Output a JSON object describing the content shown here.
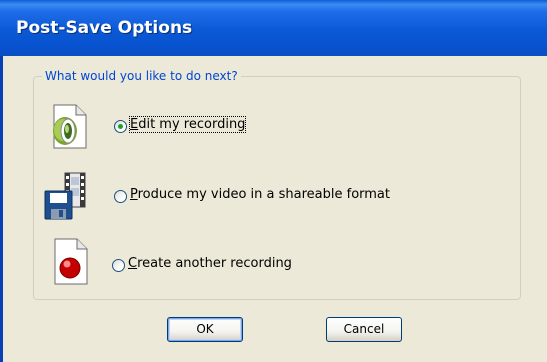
{
  "window": {
    "title": "Post-Save Options"
  },
  "group": {
    "label": "What would you like to do next?"
  },
  "options": [
    {
      "mnemonic": "E",
      "rest": "dit my recording",
      "selected": true,
      "icon": "edit-recording-icon"
    },
    {
      "mnemonic": "P",
      "rest": "roduce my video in a shareable format",
      "selected": false,
      "icon": "produce-video-icon"
    },
    {
      "mnemonic": "C",
      "rest": "reate another recording",
      "selected": false,
      "icon": "new-recording-icon"
    }
  ],
  "buttons": {
    "ok": "OK",
    "cancel": "Cancel"
  },
  "colors": {
    "titlebar": "#0a58d5",
    "dialog_bg": "#ece9d8",
    "group_label": "#0046d5",
    "radio_selected": "#21a121"
  }
}
